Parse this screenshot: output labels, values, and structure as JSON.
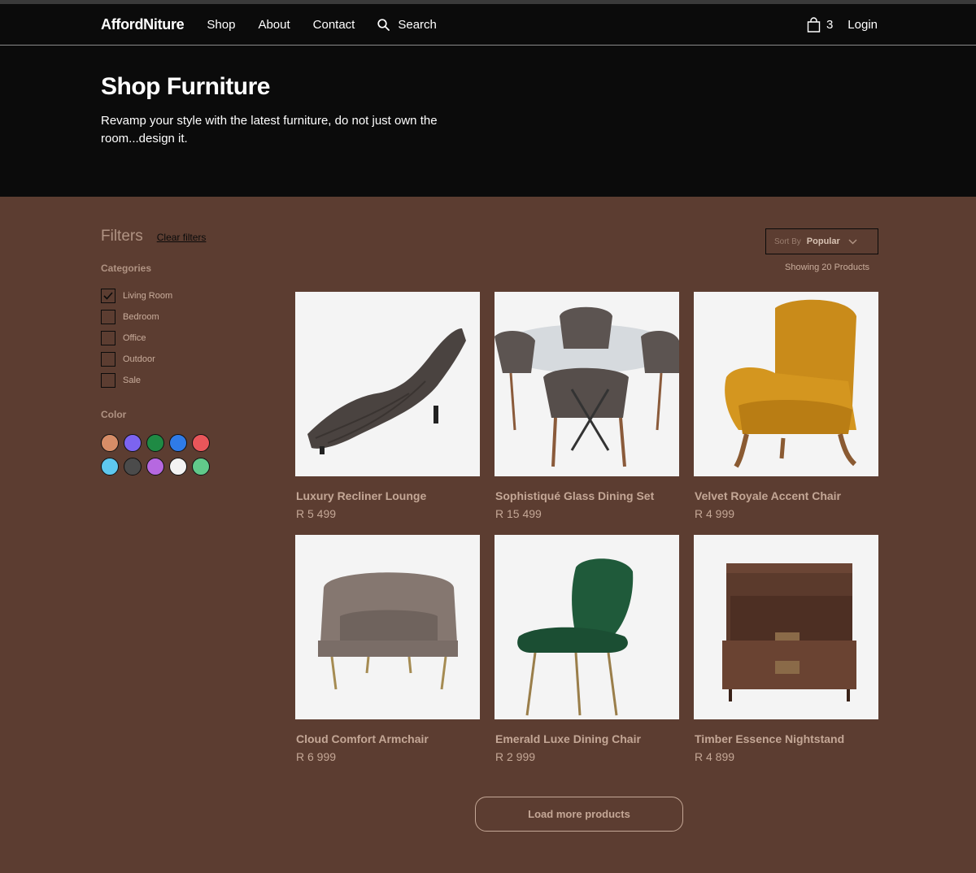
{
  "nav": {
    "brand": "AffordNiture",
    "links": [
      "Shop",
      "About",
      "Contact"
    ],
    "search_label": "Search",
    "cart_count": "3",
    "login_label": "Login"
  },
  "hero": {
    "title": "Shop Furniture",
    "subtitle": "Revamp your style with the latest furniture, do not just own the room...design it."
  },
  "filters": {
    "title": "Filters",
    "clear_label": "Clear filters",
    "categories_title": "Categories",
    "categories": [
      {
        "label": "Living Room",
        "checked": true
      },
      {
        "label": "Bedroom",
        "checked": false
      },
      {
        "label": "Office",
        "checked": false
      },
      {
        "label": "Outdoor",
        "checked": false
      },
      {
        "label": "Sale",
        "checked": false
      }
    ],
    "color_title": "Color",
    "colors": [
      "#d78d67",
      "#7c64f0",
      "#1f8a44",
      "#2f7be8",
      "#e9565a",
      "#5ec8ef",
      "#4b4b4b",
      "#b668e0",
      "#f3f3f3",
      "#61c98a"
    ]
  },
  "sort": {
    "label": "Sort By",
    "value": "Popular"
  },
  "showing_text": "Showing 20 Products",
  "products": [
    {
      "name": "Luxury Recliner Lounge",
      "price": "R 5 499",
      "image": "chaise-lounge"
    },
    {
      "name": "Sophistiqué Glass Dining Set",
      "price": "R 15 499",
      "image": "dining-set"
    },
    {
      "name": "Velvet Royale Accent Chair",
      "price": "R 4 999",
      "image": "accent-chair"
    },
    {
      "name": "Cloud Comfort Armchair",
      "price": "R 6 999",
      "image": "armchair"
    },
    {
      "name": "Emerald Luxe Dining Chair",
      "price": "R 2 999",
      "image": "dining-chair"
    },
    {
      "name": "Timber Essence Nightstand",
      "price": "R 4 899",
      "image": "nightstand"
    }
  ],
  "load_more_label": "Load more products"
}
